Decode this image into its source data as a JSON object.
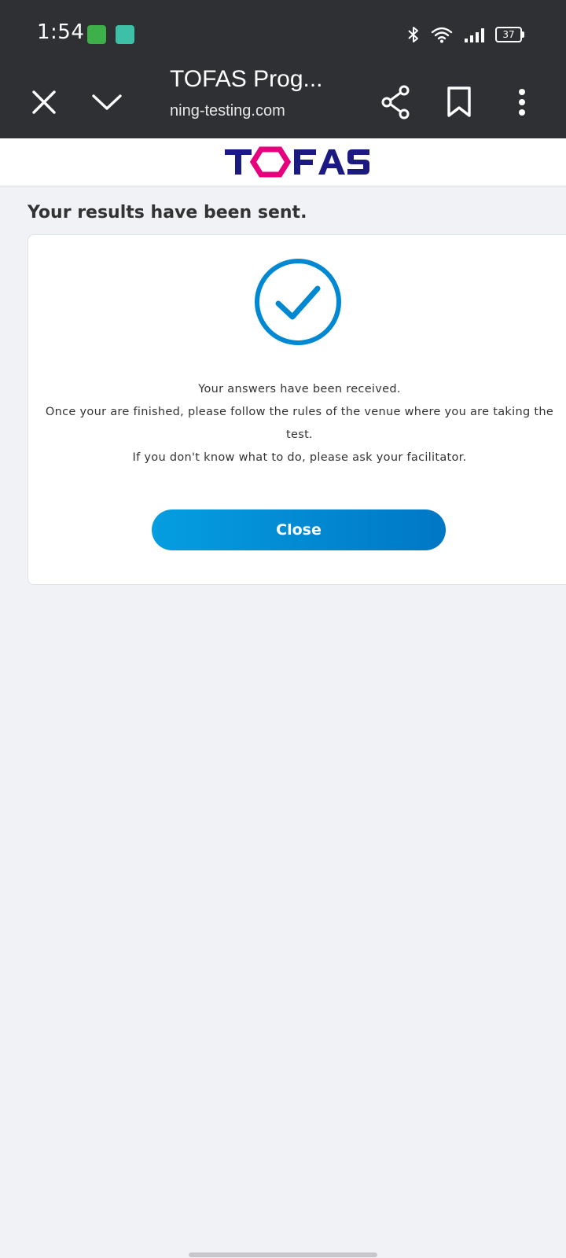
{
  "status_bar": {
    "time": "1:54",
    "battery": "37"
  },
  "browser": {
    "title": "TOFAS Prog...",
    "url": "ning-testing.com"
  },
  "site": {
    "logo_text": "TOFAS",
    "logo_colors": {
      "primary": "#1a1a80",
      "accent": "#e6007e"
    }
  },
  "main": {
    "title": "Your results have been sent.",
    "message_lines": [
      "Your answers have been received.",
      "Once your are finished, please follow the rules of the venue where you are taking the",
      "test.",
      "If you don't know what to do, please ask your facilitator."
    ],
    "close_label": "Close"
  },
  "colors": {
    "chrome_bg": "#2f3033",
    "page_bg": "#f0f2f6",
    "accent_blue": "#0088d2"
  },
  "icons": {
    "toolbar": [
      "close-icon",
      "chevron-down-icon",
      "share-icon",
      "bookmark-icon",
      "more-vert-icon"
    ],
    "status": [
      "bluetooth-icon",
      "wifi-icon",
      "signal-icon",
      "battery-icon"
    ],
    "content": "check-circle-icon"
  }
}
